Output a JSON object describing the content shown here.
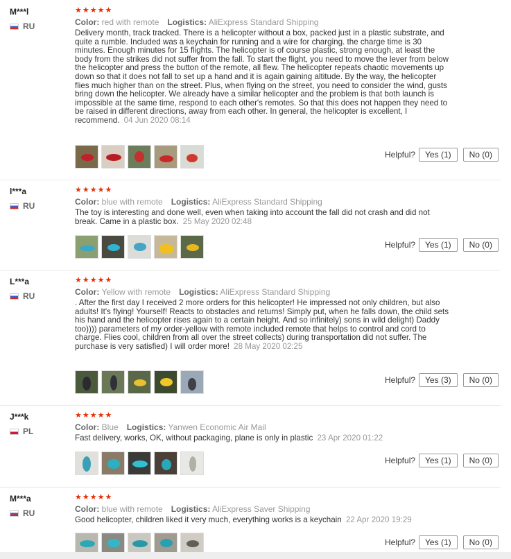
{
  "helpful_label": "Helpful?",
  "reviews": [
    {
      "user": "M***l",
      "country": "RU",
      "stars": "★★★★★",
      "color_label": "Color:",
      "color": "red with remote",
      "logistics_label": "Logistics:",
      "logistics": "AliExpress Standard Shipping",
      "text": "Delivery month, track tracked. There is a helicopter without a box, packed just in a plastic substrate, and quite a rumble. Included was a keychain for running and a wire for charging. the charge time is 30 minutes. Enough minutes for 15 flights. The helicopter is of course plastic, strong enough, at least the body from the strikes did not suffer from the fall. To start the flight, you need to move the lever from below the helicopter and press the button of the remote, all flew. The helicopter repeats chaotic movements up down so that it does not fall to set up a hand and it is again gaining altitude. By the way, the helicopter flies much higher than on the street. Plus, when flying on the street, you need to consider the wind, gusts bring down the helicopter. We already have a similar helicopter and the problem is that both launch is impossible at the same time, respond to each other's remotes. So that this does not happen they need to be raised in different directions, away from each other. In general, the helicopter is excellent, I recommend.",
      "date": "04 Jun 2020 08:14",
      "yes": "Yes (1)",
      "no": "No (0)"
    },
    {
      "user": "l***a",
      "country": "RU",
      "stars": "★★★★★",
      "color_label": "Color:",
      "color": "blue with remote",
      "logistics_label": "Logistics:",
      "logistics": "AliExpress Standard Shipping",
      "text": "The toy is interesting and done well, even when taking into account the fall did not crash and did not break. Came in a plastic box.",
      "date": "25 May 2020 02:48",
      "yes": "Yes (1)",
      "no": "No (0)"
    },
    {
      "user": "L***a",
      "country": "RU",
      "stars": "★★★★★",
      "color_label": "Color:",
      "color": "Yellow with remote",
      "logistics_label": "Logistics:",
      "logistics": "AliExpress Standard Shipping",
      "text": ". After the first day I received 2 more orders for this helicopter! He impressed not only children, but also adults! It's flying! Yourself! Reacts to obstacles and returns! Simply put, when he falls down, the child sets his hand and the helicopter rises again to a certain height. And so infinitely) sons in wild delight) Daddy too)))) parameters of my order-yellow with remote included remote that helps to control and cord to charge. Flies cool, children from all over the street collects) during transportation did not suffer. The purchase is very satisfied) I will order more!",
      "date": "28 May 2020 02:25",
      "yes": "Yes (3)",
      "no": "No (0)"
    },
    {
      "user": "J***k",
      "country": "PL",
      "stars": "★★★★★",
      "color_label": "Color:",
      "color": "Blue",
      "logistics_label": "Logistics:",
      "logistics": "Yanwen Economic Air Mail",
      "text": "Fast delivery, works, OK, without packaging, plane is only in plastic",
      "date": "23 Apr 2020 01:22",
      "yes": "Yes (1)",
      "no": "No (0)"
    },
    {
      "user": "M***a",
      "country": "RU",
      "stars": "★★★★★",
      "color_label": "Color:",
      "color": "blue with remote",
      "logistics_label": "Logistics:",
      "logistics": "AliExpress Saver Shipping",
      "text": "Good helicopter, children liked it very much, everything works is a keychain",
      "date": "22 Apr 2020 19:29",
      "yes": "Yes (1)",
      "no": "No (0)"
    }
  ]
}
